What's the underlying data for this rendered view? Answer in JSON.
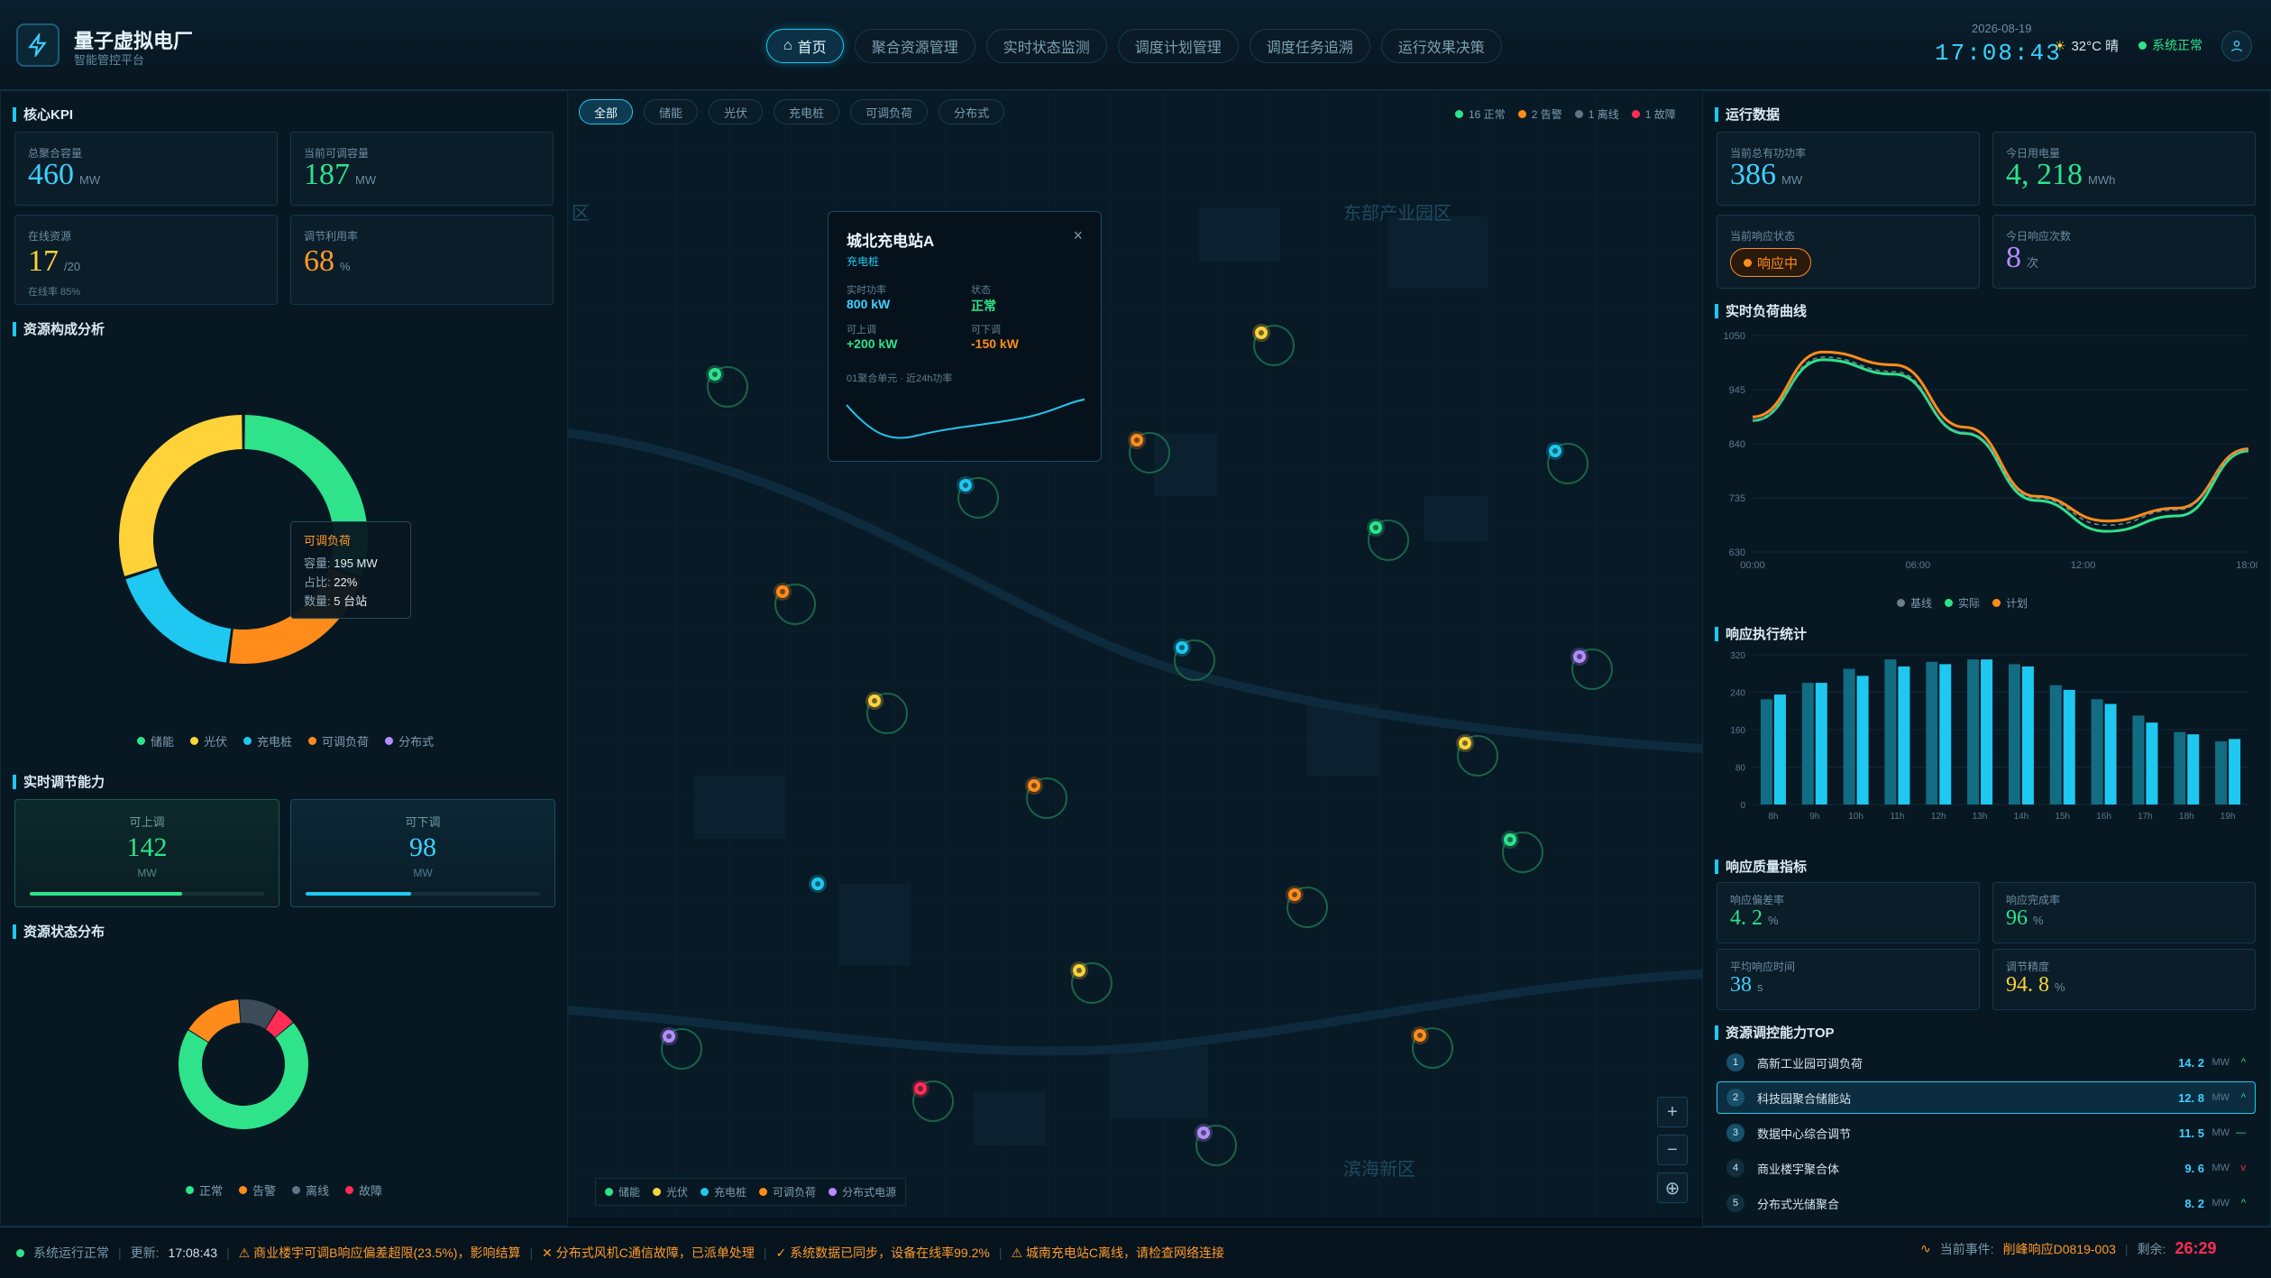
{
  "app": {
    "title": "量子虚拟电厂",
    "subtitle": "智能管控平台"
  },
  "nav": [
    {
      "label": "首页",
      "active": true
    },
    {
      "label": "聚合资源管理"
    },
    {
      "label": "实时状态监测"
    },
    {
      "label": "调度计划管理"
    },
    {
      "label": "调度任务追溯"
    },
    {
      "label": "运行效果决策"
    }
  ],
  "header": {
    "date": "2026-08-19",
    "time": "17:08:43",
    "weather": "32°C 晴",
    "status": "系统正常"
  },
  "kpi": {
    "title": "核心KPI",
    "cards": [
      {
        "label": "总聚合容量",
        "value": "460",
        "unit": "MW",
        "color": "#3fd0ff"
      },
      {
        "label": "当前可调容量",
        "value": "187",
        "unit": "MW",
        "color": "#2ee38a"
      },
      {
        "label": "在线资源",
        "value": "17",
        "unit": "/20",
        "sub": "在线率 85%",
        "color": "#ffd23a"
      },
      {
        "label": "调节利用率",
        "value": "68",
        "unit": "%",
        "color": "#ff9a2a"
      }
    ]
  },
  "composition": {
    "title": "资源构成分析",
    "tooltip": {
      "name": "可调负荷",
      "rows": [
        {
          "k": "容量:",
          "v": "195 MW"
        },
        {
          "k": "占比:",
          "v": "22%"
        },
        {
          "k": "数量:",
          "v": "5 台站"
        }
      ]
    },
    "legend": [
      {
        "name": "储能",
        "color": "#2ee38a"
      },
      {
        "name": "光伏",
        "color": "#ffd23a"
      },
      {
        "name": "充电桩",
        "color": "#1ec8f0"
      },
      {
        "name": "可调负荷",
        "color": "#ff8c1a"
      },
      {
        "name": "分布式",
        "color": "#b48cff"
      }
    ]
  },
  "regulation": {
    "title": "实时调节能力",
    "up": {
      "label": "可上调",
      "value": "142",
      "unit": "MW",
      "fill": 0.65
    },
    "down": {
      "label": "可下调",
      "value": "98",
      "unit": "MW",
      "fill": 0.45
    }
  },
  "status": {
    "title": "资源状态分布",
    "legend": [
      {
        "name": "正常",
        "color": "#2ee38a"
      },
      {
        "name": "告警",
        "color": "#ff8c1a"
      },
      {
        "name": "离线",
        "color": "#5f7484"
      },
      {
        "name": "故障",
        "color": "#ff2d55"
      }
    ]
  },
  "map": {
    "filters": [
      "全部",
      "储能",
      "光伏",
      "充电桩",
      "可调负荷",
      "分布式"
    ],
    "counts": [
      {
        "label": "16 正常",
        "color": "#2ee38a"
      },
      {
        "label": "2 告警",
        "color": "#ff8c1a"
      },
      {
        "label": "1 离线",
        "color": "#5f7484"
      },
      {
        "label": "1 故障",
        "color": "#ff2d55"
      }
    ],
    "districts": [
      "东部产业园区",
      "滨海新区",
      "区"
    ],
    "popup": {
      "title": "城北充电站A",
      "type": "充电桩",
      "fields": [
        {
          "k": "实时功率",
          "v": "800 kW",
          "c": "#3fd0ff"
        },
        {
          "k": "状态",
          "v": "正常",
          "c": "#2ee38a"
        },
        {
          "k": "可上调",
          "v": "+200 kW",
          "c": "#2ee38a"
        },
        {
          "k": "可下调",
          "v": "-150 kW",
          "c": "#ff8c1a"
        }
      ],
      "note": "01聚合单元 · 近24h功率",
      "close": "×"
    },
    "legend": [
      {
        "name": "储能",
        "color": "#2ee38a"
      },
      {
        "name": "光伏",
        "color": "#ffd23a"
      },
      {
        "name": "充电桩",
        "color": "#1ec8f0"
      },
      {
        "name": "可调负荷",
        "color": "#ff8c1a"
      },
      {
        "name": "分布式电源",
        "color": "#b48cff"
      }
    ],
    "controls": [
      "+",
      "−",
      "⊕"
    ]
  },
  "runtime": {
    "title": "运行数据",
    "cards": [
      {
        "label": "当前总有功功率",
        "value": "386",
        "unit": "MW",
        "color": "#3fd0ff"
      },
      {
        "label": "今日用电量",
        "value": "4, 218",
        "unit": "MWh",
        "color": "#2ee38a"
      },
      {
        "label": "当前响应状态",
        "value": "响应中",
        "color": "#ff8c1a"
      },
      {
        "label": "今日响应次数",
        "value": "8",
        "unit": "次",
        "color": "#b48cff"
      }
    ]
  },
  "load_chart": {
    "title": "实时负荷曲线",
    "legend": [
      {
        "name": "基线",
        "color": "#6d7f8c"
      },
      {
        "name": "实际",
        "color": "#2ee38a"
      },
      {
        "name": "计划",
        "color": "#ff8c1a"
      }
    ]
  },
  "exec_chart": {
    "title": "响应执行统计"
  },
  "quality": {
    "title": "响应质量指标",
    "cards": [
      {
        "label": "响应偏差率",
        "value": "4. 2",
        "unit": "%",
        "color": "#2ee38a"
      },
      {
        "label": "响应完成率",
        "value": "96",
        "unit": "%",
        "color": "#2ee38a"
      },
      {
        "label": "平均响应时间",
        "value": "38",
        "unit": "s",
        "color": "#3fd0ff"
      },
      {
        "label": "调节精度",
        "value": "94. 8",
        "unit": "%",
        "color": "#ffd23a"
      }
    ]
  },
  "top": {
    "title": "资源调控能力TOP",
    "items": [
      {
        "rank": "1",
        "name": "高新工业园可调负荷",
        "value": "14. 2",
        "unit": "MW",
        "trend": "^"
      },
      {
        "rank": "2",
        "name": "科技园聚合储能站",
        "value": "12. 8",
        "unit": "MW",
        "trend": "^",
        "active": true
      },
      {
        "rank": "3",
        "name": "数据中心综合调节",
        "value": "11. 5",
        "unit": "MW",
        "trend": "—"
      },
      {
        "rank": "4",
        "name": "商业楼宇聚合体",
        "value": "9. 6",
        "unit": "MW",
        "trend": "v"
      },
      {
        "rank": "5",
        "name": "分布式光储聚合",
        "value": "8. 2",
        "unit": "MW",
        "trend": "^"
      }
    ]
  },
  "footer": {
    "sys": "系统运行正常",
    "update_label": "更新:",
    "update_time": "17:08:43",
    "alerts": [
      {
        "text": "⚠ 商业楼宇可调B响应偏差超限(23.5%)，影响结算",
        "color": "#ff9a2a"
      },
      {
        "text": "✕ 分布式风机C通信故障，已派单处理",
        "color": "#ff9a2a"
      },
      {
        "text": "✓ 系统数据已同步，设备在线率99.2%",
        "color": "#ff9a2a"
      },
      {
        "text": "⚠ 城南充电站C离线，请检查网络连接",
        "color": "#ff9a2a"
      }
    ],
    "event_label": "当前事件:",
    "event_id": "削峰响应D0819-003",
    "remain_label": "剩余:",
    "remain": "26:29"
  },
  "chart_data": [
    {
      "type": "pie",
      "title": "资源构成分析",
      "categories": [
        "储能",
        "可调负荷",
        "充电桩",
        "光伏"
      ],
      "values": [
        30,
        22,
        18,
        30
      ]
    },
    {
      "type": "pie",
      "title": "资源状态分布",
      "categories": [
        "正常",
        "告警",
        "离线",
        "故障"
      ],
      "values": [
        70,
        15,
        10,
        5
      ]
    },
    {
      "type": "line",
      "title": "实时负荷曲线",
      "x": [
        "00:00",
        "06:00",
        "12:00",
        "18:00"
      ],
      "ylim": [
        630,
        1050
      ],
      "yticks": [
        630,
        735,
        840,
        945,
        1050
      ],
      "series": [
        {
          "name": "实际",
          "values": [
            885,
            1003,
            975,
            860,
            730,
            670,
            700,
            826
          ]
        },
        {
          "name": "计划",
          "values": [
            892,
            1018,
            993,
            872,
            738,
            690,
            715,
            830
          ]
        },
        {
          "name": "基线",
          "values": [
            885,
            1008,
            980,
            862,
            735,
            682,
            712,
            828
          ]
        }
      ]
    },
    {
      "type": "bar",
      "title": "响应执行统计",
      "categories": [
        "8h",
        "9h",
        "10h",
        "11h",
        "12h",
        "13h",
        "14h",
        "15h",
        "16h",
        "17h",
        "18h",
        "19h"
      ],
      "ylim": [
        0,
        320
      ],
      "yticks": [
        0,
        80,
        160,
        240,
        320
      ],
      "series": [
        {
          "values": [
            225,
            260,
            290,
            310,
            305,
            310,
            300,
            255,
            225,
            190,
            155,
            135
          ]
        },
        {
          "values": [
            235,
            260,
            275,
            295,
            300,
            310,
            295,
            245,
            215,
            175,
            150,
            140
          ]
        }
      ]
    }
  ]
}
